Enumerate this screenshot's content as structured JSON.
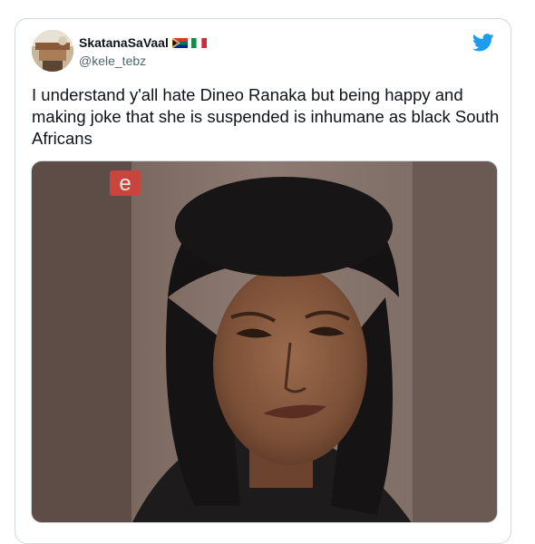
{
  "tweet": {
    "display_name": "SkatanaSaVaal",
    "flags": [
      "south-africa-flag",
      "italy-flag"
    ],
    "handle": "@kele_tebz",
    "text": "I understand y'all hate Dineo Ranaka but being happy and making joke that she is suspended is inhumane as black South Africans",
    "logo_icon": "twitter-bird-icon",
    "media": {
      "channel_logo_text": "e",
      "description_icon": "meme-photo"
    }
  },
  "colors": {
    "twitter_blue": "#1d9bf0",
    "text_primary": "#0f1419",
    "text_secondary": "#536471",
    "border": "#cfd9de",
    "channel_logo": "#c8443c"
  }
}
